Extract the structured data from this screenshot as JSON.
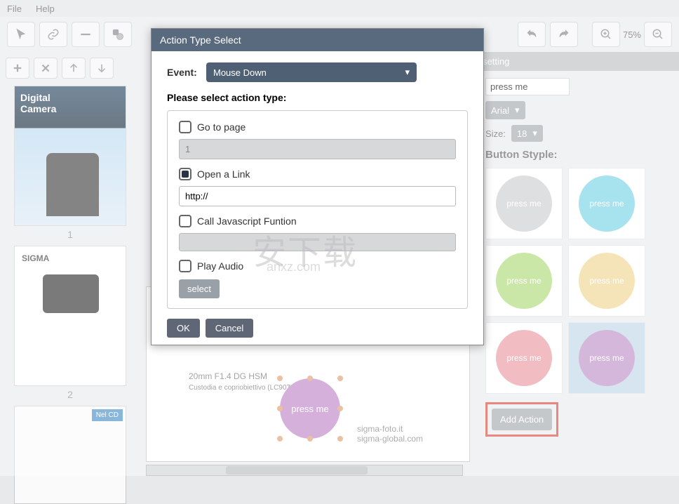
{
  "menu": {
    "file": "File",
    "help": "Help"
  },
  "zoom": {
    "value": "75%"
  },
  "pages": {
    "p1": "1",
    "p2": "2"
  },
  "canvas": {
    "headline": "20mm F1.4 DG HSM",
    "sub": "Custodia e copriobiettivo (LC907-01) inclusi",
    "pressme": "press me",
    "links": "sigma-foto.it\nsigma-global.com"
  },
  "right": {
    "header": "setting",
    "textval": "press me",
    "font": "Arial",
    "sizelbl": "Size:",
    "sizeval": "18",
    "stylehdr": "Button Styple:",
    "pm": "press me",
    "addaction": "Add Action"
  },
  "modal": {
    "title": "Action Type Select",
    "eventlbl": "Event:",
    "eventval": "Mouse Down",
    "instruct": "Please select action type:",
    "opt_goto": "Go to page",
    "goto_val": "1",
    "opt_link": "Open a Link",
    "link_val": "http://",
    "opt_js": "Call Javascript Funtion",
    "opt_audio": "Play Audio",
    "audio_sel": "select",
    "ok": "OK",
    "cancel": "Cancel"
  }
}
